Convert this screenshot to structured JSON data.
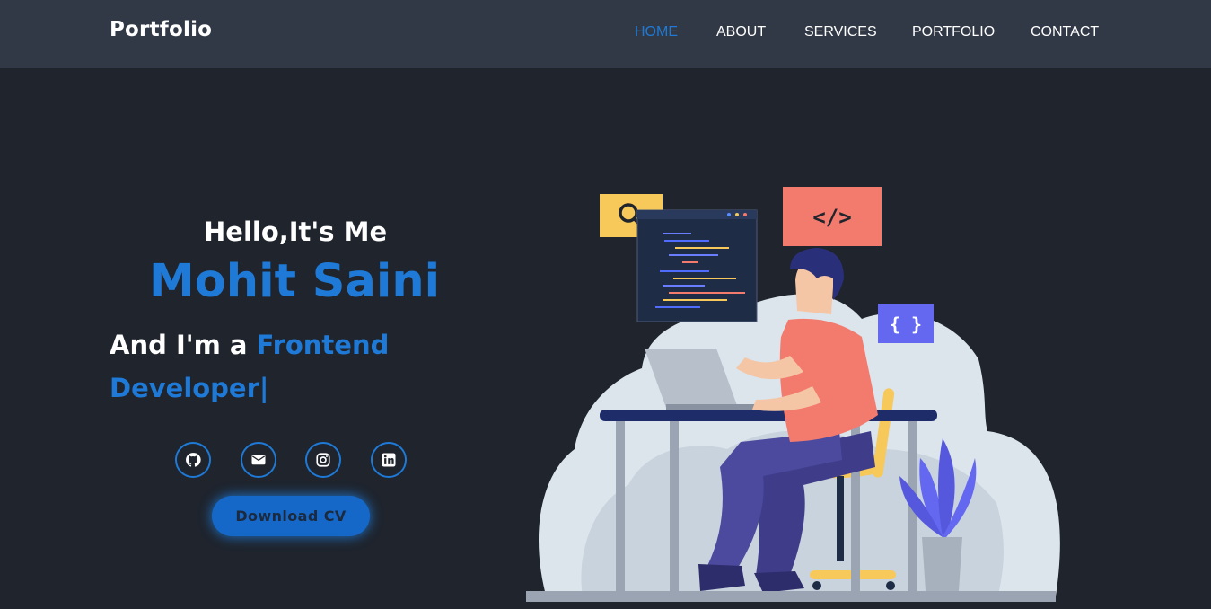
{
  "header": {
    "logo": "Portfolio",
    "nav": [
      {
        "label": "HOME",
        "active": true
      },
      {
        "label": "ABOUT",
        "active": false
      },
      {
        "label": "SERVICES",
        "active": false
      },
      {
        "label": "PORTFOLIO",
        "active": false
      },
      {
        "label": "CONTACT",
        "active": false
      }
    ]
  },
  "hero": {
    "greeting": "Hello,It's Me",
    "name": "Mohit Saini",
    "role_prefix": "And I'm a",
    "role_typed": "Frontend Developer|",
    "cta_label": "Download CV",
    "socials": [
      {
        "icon": "github-icon"
      },
      {
        "icon": "mail-icon"
      },
      {
        "icon": "instagram-icon"
      },
      {
        "icon": "linkedin-icon"
      }
    ]
  },
  "illustration": {
    "code_tag": "</>",
    "braces_tag": "{ }"
  },
  "colors": {
    "background": "#1f242d",
    "header": "#323946",
    "accent": "#1e7ad6"
  }
}
